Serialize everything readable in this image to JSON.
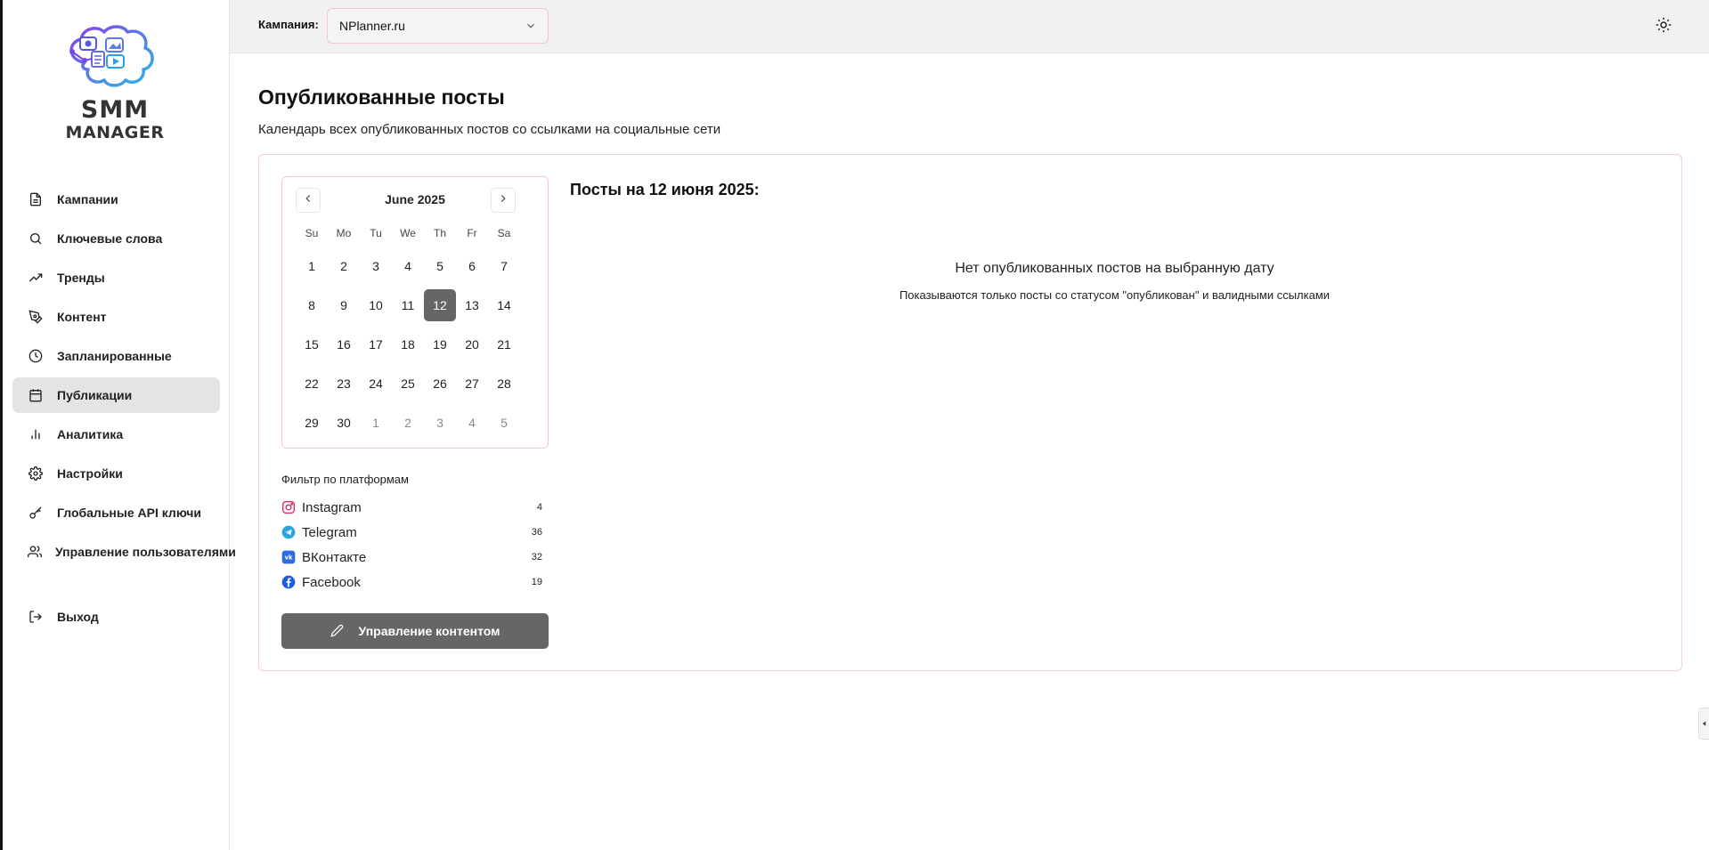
{
  "app": {
    "logo_line1": "SMM",
    "logo_line2": "MANAGER"
  },
  "sidebar": {
    "items": [
      {
        "label": "Кампании",
        "icon": "document-icon"
      },
      {
        "label": "Ключевые слова",
        "icon": "search-icon"
      },
      {
        "label": "Тренды",
        "icon": "trending-up-icon"
      },
      {
        "label": "Контент",
        "icon": "pen-tool-icon"
      },
      {
        "label": "Запланированные",
        "icon": "clock-icon"
      },
      {
        "label": "Публикации",
        "icon": "calendar-icon",
        "active": true
      },
      {
        "label": "Аналитика",
        "icon": "bar-chart-icon"
      },
      {
        "label": "Настройки",
        "icon": "gear-icon"
      },
      {
        "label": "Глобальные API ключи",
        "icon": "key-icon"
      },
      {
        "label": "Управление пользователями",
        "icon": "users-icon"
      }
    ],
    "logout_label": "Выход"
  },
  "topbar": {
    "campaign_label": "Кампания:",
    "campaign_value": "NPlanner.ru"
  },
  "page": {
    "title": "Опубликованные посты",
    "subtitle": "Календарь всех опубликованных постов со ссылками на социальные сети"
  },
  "calendar": {
    "month_label": "June 2025",
    "weekdays": [
      "Su",
      "Mo",
      "Tu",
      "We",
      "Th",
      "Fr",
      "Sa"
    ],
    "weeks": [
      [
        {
          "d": "1"
        },
        {
          "d": "2"
        },
        {
          "d": "3"
        },
        {
          "d": "4"
        },
        {
          "d": "5"
        },
        {
          "d": "6"
        },
        {
          "d": "7"
        }
      ],
      [
        {
          "d": "8"
        },
        {
          "d": "9"
        },
        {
          "d": "10"
        },
        {
          "d": "11"
        },
        {
          "d": "12",
          "selected": true
        },
        {
          "d": "13"
        },
        {
          "d": "14"
        }
      ],
      [
        {
          "d": "15"
        },
        {
          "d": "16"
        },
        {
          "d": "17"
        },
        {
          "d": "18"
        },
        {
          "d": "19"
        },
        {
          "d": "20"
        },
        {
          "d": "21"
        }
      ],
      [
        {
          "d": "22"
        },
        {
          "d": "23"
        },
        {
          "d": "24"
        },
        {
          "d": "25"
        },
        {
          "d": "26"
        },
        {
          "d": "27"
        },
        {
          "d": "28"
        }
      ],
      [
        {
          "d": "29"
        },
        {
          "d": "30"
        },
        {
          "d": "1",
          "muted": true
        },
        {
          "d": "2",
          "muted": true
        },
        {
          "d": "3",
          "muted": true
        },
        {
          "d": "4",
          "muted": true
        },
        {
          "d": "5",
          "muted": true
        }
      ]
    ]
  },
  "filter": {
    "title": "Фильтр по платформам",
    "platforms": [
      {
        "name": "Instagram",
        "count": "4",
        "icon": "instagram-icon",
        "color": "#e1306c"
      },
      {
        "name": "Telegram",
        "count": "36",
        "icon": "telegram-icon",
        "color": "#2aa3e0"
      },
      {
        "name": "ВКонтакте",
        "count": "32",
        "icon": "vk-icon",
        "color": "#2d6be0"
      },
      {
        "name": "Facebook",
        "count": "19",
        "icon": "facebook-icon",
        "color": "#1d5ce6"
      }
    ]
  },
  "manage_button_label": "Управление контентом",
  "posts": {
    "heading": "Посты на 12 июня 2025:",
    "empty_main": "Нет опубликованных постов на выбранную дату",
    "empty_sub": "Показываются только посты со статусом \"опубликован\" и валидными ссылками"
  },
  "colors": {
    "accent_border": "#f3c9cf",
    "selected_day": "#666666",
    "button_bg": "#666666",
    "active_nav": "#e4e4e4"
  }
}
